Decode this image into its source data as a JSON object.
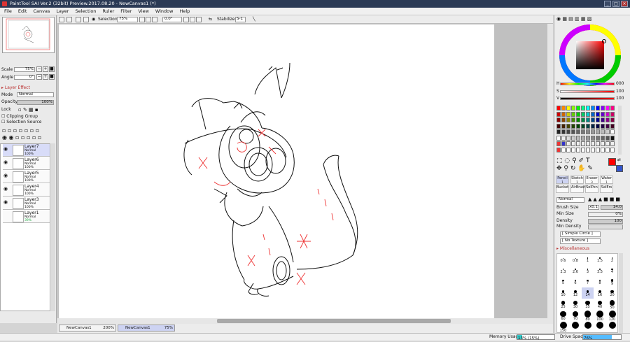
{
  "window": {
    "title": "PaintTool SAI Ver.2 (32bit) Preview.2017.08.20 - NewCanvas1 (*)"
  },
  "menu": [
    "File",
    "Edit",
    "Canvas",
    "Layer",
    "Selection",
    "Ruler",
    "Filter",
    "View",
    "Window",
    "Help"
  ],
  "navigator": {
    "scale_label": "Scale",
    "scale_value": "75%",
    "angle_label": "Angle",
    "angle_value": "0°"
  },
  "layer_panel": {
    "effect_label": "Layer Effect",
    "mode_label": "Mode",
    "mode_value": "Normal",
    "opacity_label": "Opacity",
    "opacity_value": "100%",
    "lock_label": "Lock",
    "clipping_label": "Clipping Group",
    "selection_source_label": "Selection Source",
    "layers": [
      {
        "name": "Layer7",
        "mode": "Normal",
        "opacity": "100%",
        "visible": true,
        "selected": true
      },
      {
        "name": "Layer6",
        "mode": "Normal",
        "opacity": "100%",
        "visible": true,
        "selected": false
      },
      {
        "name": "Layer5",
        "mode": "Normal",
        "opacity": "100%",
        "visible": true,
        "selected": false
      },
      {
        "name": "Layer4",
        "mode": "Normal",
        "opacity": "100%",
        "visible": true,
        "selected": false
      },
      {
        "name": "Layer3",
        "mode": "Normal",
        "opacity": "100%",
        "visible": true,
        "selected": false
      },
      {
        "name": "Layer1",
        "mode": "Normal",
        "opacity": "39%",
        "visible": false,
        "selected": false
      }
    ]
  },
  "toolbar": {
    "selection_label": "Selection",
    "zoom_value": "75%",
    "angle_value": "0.0°",
    "stabilizer_label": "Stabilizer",
    "stabilizer_value": "S-1"
  },
  "color": {
    "h_label": "H",
    "h_value": "000",
    "s_label": "S",
    "s_value": "100",
    "v_label": "V",
    "v_value": "100",
    "primary": "#ff0000",
    "secondary": "#3355cc"
  },
  "brushes": [
    {
      "name": "Pencil",
      "size": "1",
      "selected": true
    },
    {
      "name": "Sketch",
      "size": "1",
      "selected": false
    },
    {
      "name": "Eraser",
      "size": "3",
      "selected": false
    },
    {
      "name": "Water",
      "size": "1",
      "selected": false
    },
    {
      "name": "Bucket",
      "size": "",
      "selected": false
    },
    {
      "name": "AirBrush",
      "size": "",
      "selected": false
    },
    {
      "name": "SelPen",
      "size": "",
      "selected": false
    },
    {
      "name": "SelErs",
      "size": "",
      "selected": false
    }
  ],
  "brush_settings": {
    "mode_value": "Normal",
    "brush_size_label": "Brush Size",
    "brush_size_mult": "x0.1",
    "brush_size_value": "14.0",
    "min_size_label": "Min Size",
    "min_size_value": "0%",
    "density_label": "Density",
    "density_value": "100",
    "min_density_label": "Min Density",
    "shape_value": "[ Simple Circle ]",
    "texture_value": "[ No Texture ]",
    "misc_label": "Miscellaneous"
  },
  "brush_sizes": [
    "0.6",
    "0.8",
    "1",
    "1.5",
    "2",
    "2.3",
    "2.6",
    "3",
    "3.5",
    "4",
    "5",
    "6",
    "7",
    "8",
    "9",
    "10",
    "12",
    "14",
    "16",
    "20",
    "25",
    "30",
    "35",
    "40",
    "50",
    "60",
    "70",
    "80",
    "100",
    "120",
    "150",
    "",
    "",
    "",
    ""
  ],
  "tabs": [
    {
      "name": "NewCanvas1",
      "zoom": "200%",
      "active": false
    },
    {
      "name": "NewCanvas1",
      "zoom": "75%",
      "active": true
    }
  ],
  "status": {
    "memory_label": "Memory Usage",
    "memory_value": "13% (15%)",
    "memory_fraction": 0.13,
    "drive_label": "Drive Space",
    "drive_value": "76%",
    "drive_fraction": 0.76
  }
}
